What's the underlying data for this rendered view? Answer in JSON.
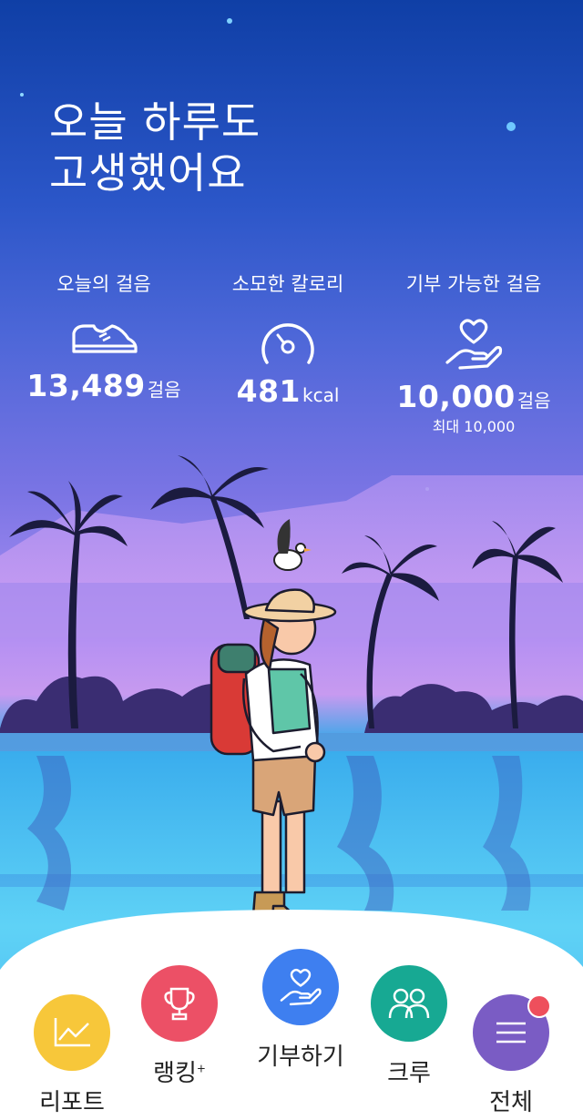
{
  "greeting": {
    "line1": "오늘 하루도",
    "line2": "고생했어요"
  },
  "stats": [
    {
      "label": "오늘의 걸음",
      "value": "13,489",
      "unit": "걸음",
      "icon": "sneaker-icon"
    },
    {
      "label": "소모한 칼로리",
      "value": "481",
      "unit": "kcal",
      "icon": "gauge-icon"
    },
    {
      "label": "기부 가능한 걸음",
      "value": "10,000",
      "unit": "걸음",
      "max": "최대 10,000",
      "icon": "heart-hand-icon"
    }
  ],
  "nav": [
    {
      "label": "리포트",
      "icon": "chart-icon",
      "color": "#f7c73a"
    },
    {
      "label": "랭킹",
      "sup": "+",
      "icon": "trophy-icon",
      "color": "#ec5066"
    },
    {
      "label": "기부하기",
      "icon": "heart-hand-icon",
      "color": "#3e7ff0"
    },
    {
      "label": "크루",
      "icon": "people-icon",
      "color": "#17a993"
    },
    {
      "label": "전체",
      "icon": "menu-icon",
      "color": "#7a5cc4",
      "has_badge": true
    }
  ],
  "colors": {
    "sky_top": "#0f3fa6",
    "sea": "#4fc4f2",
    "nav_bg": "#ffffff"
  }
}
